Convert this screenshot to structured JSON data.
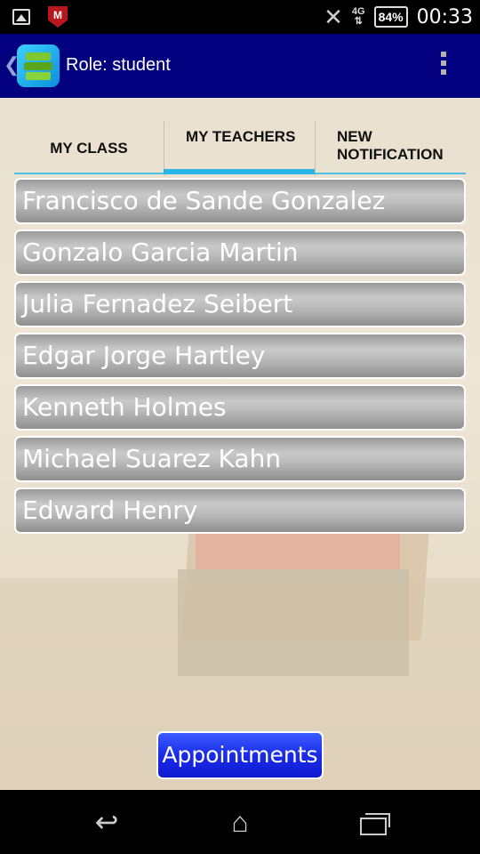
{
  "status_bar": {
    "network_label": "4G",
    "battery": "84%",
    "time": "00:33",
    "icons": [
      "image-icon",
      "mcafee-icon",
      "no-signal-icon",
      "network-icon",
      "battery-icon"
    ]
  },
  "action_bar": {
    "title": "Role: student",
    "back_glyph": "❮",
    "overflow_icon": "overflow-menu-icon"
  },
  "tabs": [
    {
      "label": "MY CLASS",
      "active": false
    },
    {
      "label": "MY TEACHERS",
      "active": true
    },
    {
      "label": "NEW NOTIFICATION",
      "active": false
    }
  ],
  "teachers": [
    "Francisco de Sande Gonzalez",
    "Gonzalo Garcia Martin",
    "Julia Fernadez Seibert",
    "Edgar Jorge Hartley",
    "Kenneth Holmes",
    "Michael Suarez Kahn",
    "Edward Henry"
  ],
  "appointments_button": "Appointments",
  "nav_bar": {
    "back_glyph": "↩",
    "home_glyph": "⌂"
  },
  "colors": {
    "action_bar": "#02007f",
    "tab_accent": "#29b6e6",
    "button_blue": "#1a2be8"
  }
}
